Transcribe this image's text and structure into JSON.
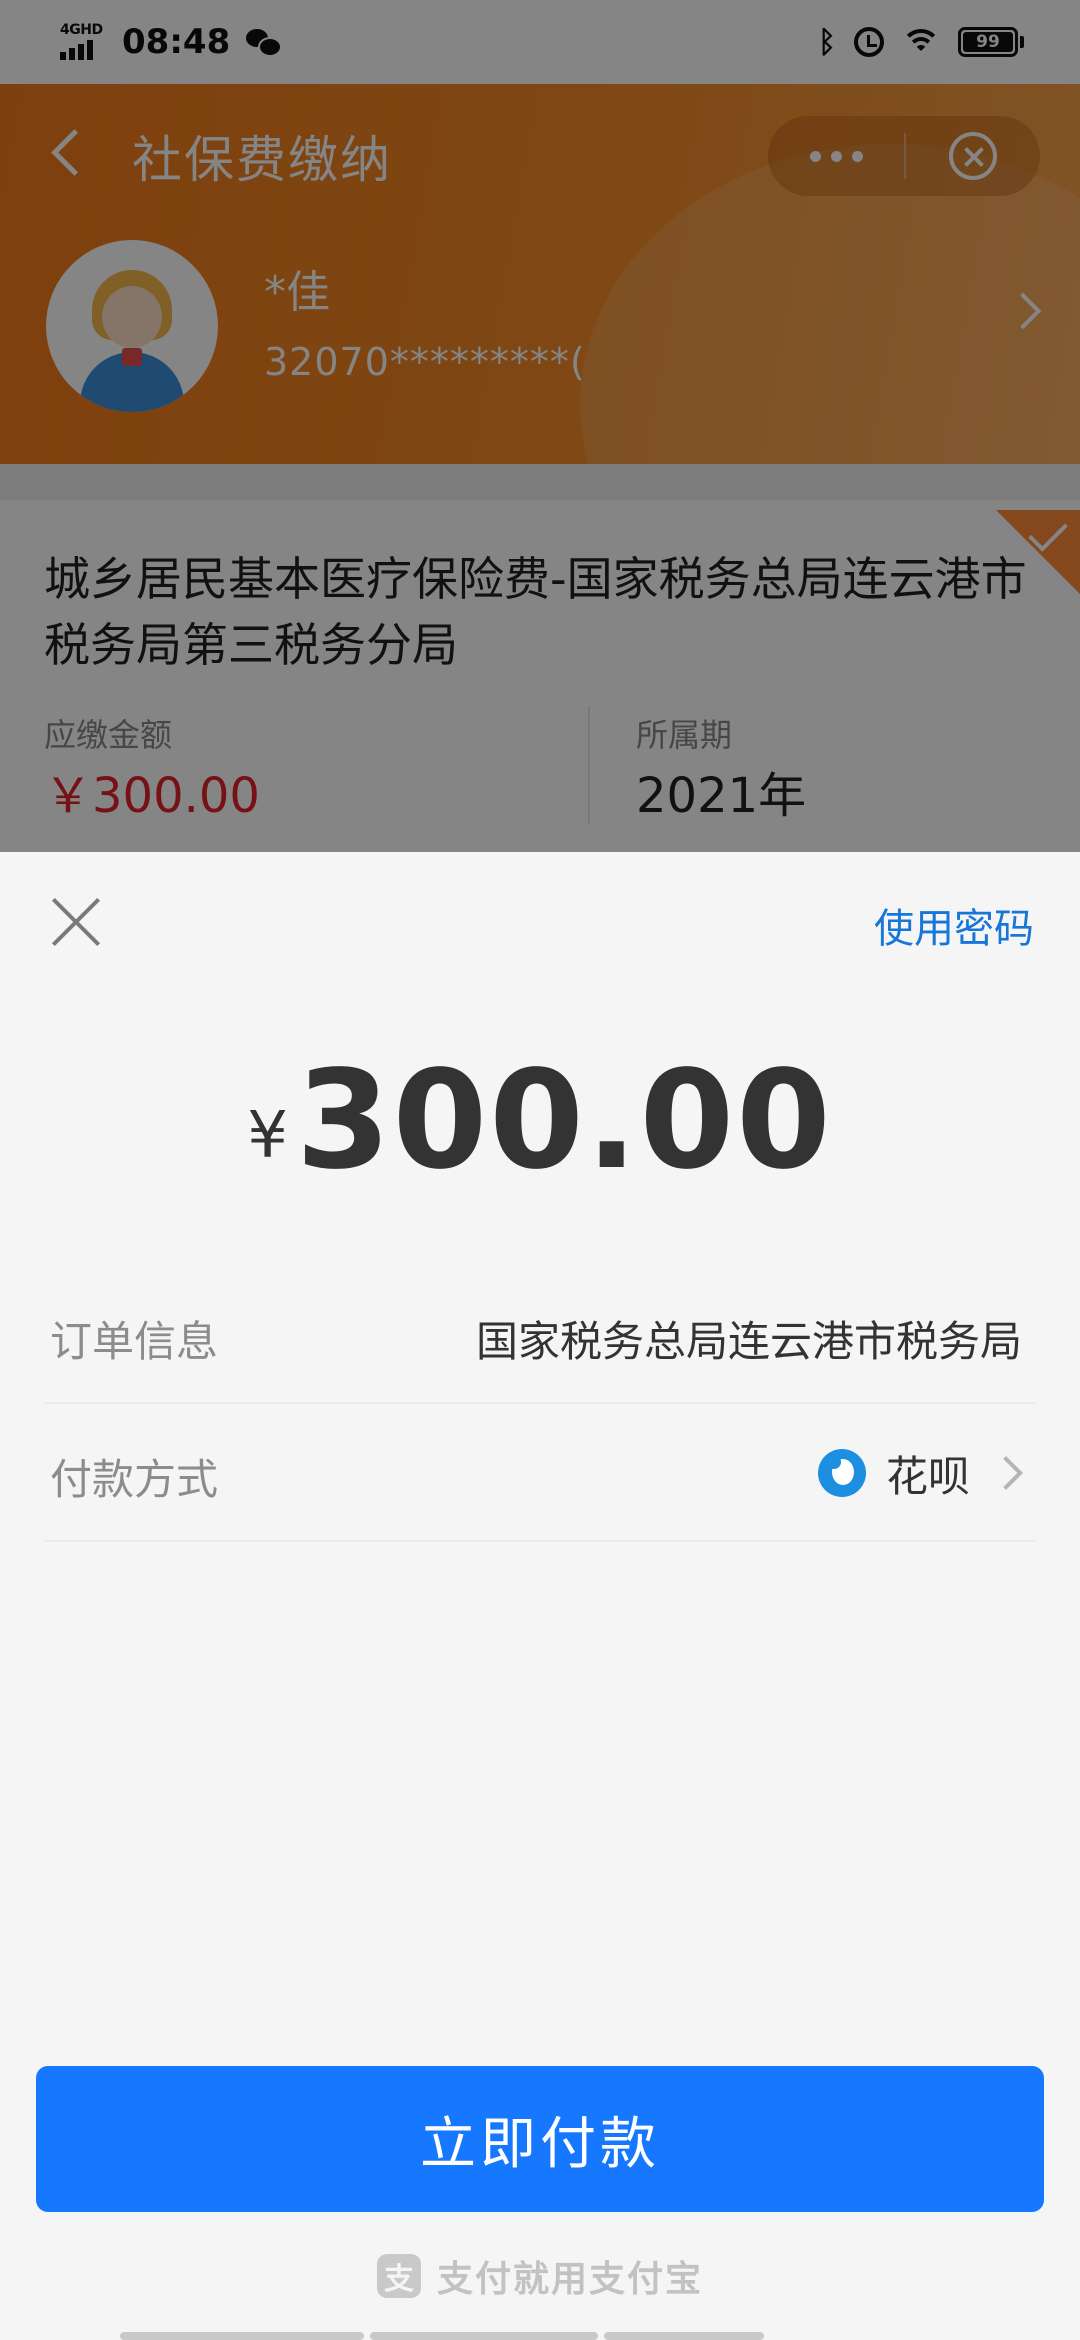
{
  "status_bar": {
    "network": "4GHD",
    "time": "08:48",
    "battery": "99"
  },
  "background_page": {
    "nav_title": "社保费缴纳",
    "user": {
      "name": "*佳",
      "id": "32070*********("
    },
    "card": {
      "title": "城乡居民基本医疗保险费-国家税务总局连云港市税务局第三税务分局",
      "amount_label": "应缴金额",
      "amount": "￥300.00",
      "period_label": "所属期",
      "period": "2021年"
    }
  },
  "payment_sheet": {
    "use_password_label": "使用密码",
    "currency_symbol": "¥",
    "amount": "300.00",
    "order_info_label": "订单信息",
    "order_info_value": "国家税务总局连云港市税务局",
    "payment_method_label": "付款方式",
    "payment_method_value": "花呗",
    "pay_button_label": "立即付款",
    "footer_text": "支付就用支付宝"
  },
  "colors": {
    "accent_blue": "#1677ff",
    "header_orange": "#f38a27",
    "amount_red": "#e2232b",
    "link_blue": "#1677d9"
  }
}
